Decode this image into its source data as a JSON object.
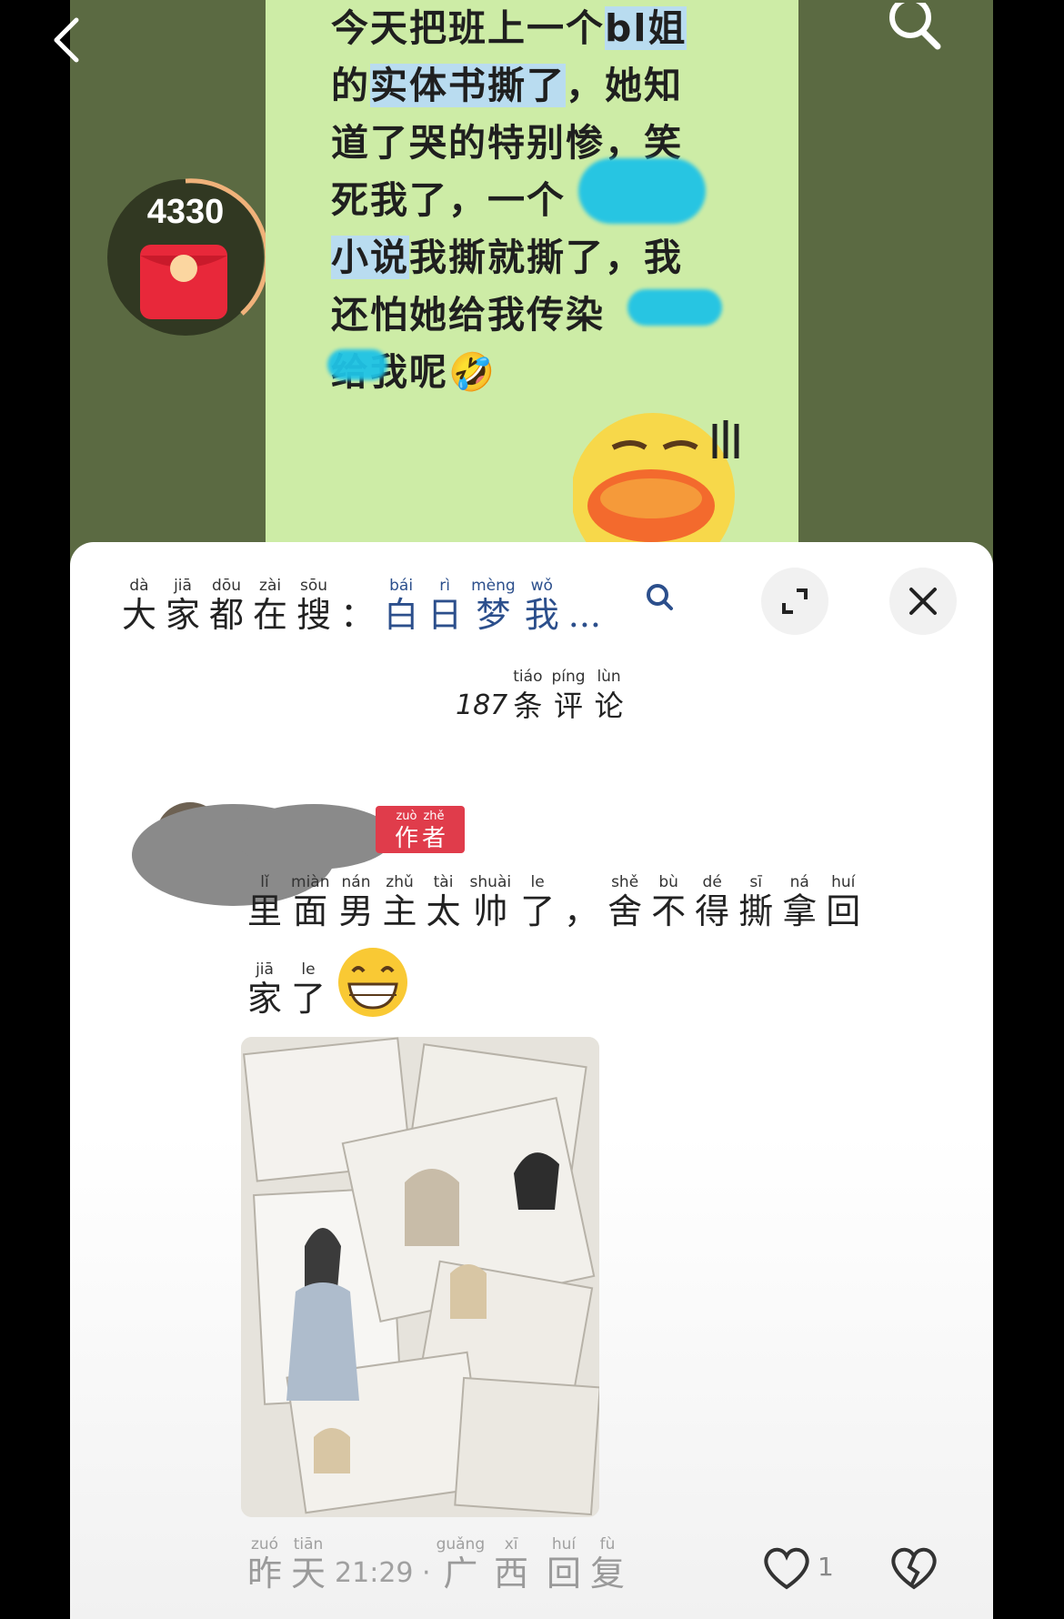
{
  "top_bar": {
    "back_icon": "chevron-left-icon",
    "search_icon": "search-icon"
  },
  "note": {
    "lines": [
      {
        "text": "今天把班上一个bl姐",
        "highlight": "bl姐"
      },
      {
        "text": "的实体书撕了，她知",
        "highlight": "实体书撕了"
      },
      {
        "text": "道了哭的特别惨，笑"
      },
      {
        "text": "死我了，一个"
      },
      {
        "text": "小说我撕就撕了，我",
        "highlight": "小说"
      },
      {
        "text": "还怕她给我传染"
      },
      {
        "text": "给我呢🤣"
      }
    ]
  },
  "red_packet": {
    "count": "4330",
    "icon": "red-packet-icon"
  },
  "sheet": {
    "search": {
      "label": [
        {
          "hz": "大",
          "py": "dà"
        },
        {
          "hz": "家",
          "py": "jiā"
        },
        {
          "hz": "都",
          "py": "dōu"
        },
        {
          "hz": "在",
          "py": "zài"
        },
        {
          "hz": "搜",
          "py": "sōu"
        }
      ],
      "colon": "：",
      "query": [
        {
          "hz": "白",
          "py": "bái"
        },
        {
          "hz": "日",
          "py": "rì"
        },
        {
          "hz": "梦",
          "py": "mèng"
        },
        {
          "hz": "我",
          "py": "wǒ"
        }
      ],
      "ellipsis": "...",
      "icon": "search-icon"
    },
    "expand_icon": "expand-icon",
    "close_icon": "close-icon",
    "comment_count": {
      "number": "187",
      "label": [
        {
          "hz": "条",
          "py": "tiáo"
        },
        {
          "hz": "评",
          "py": "píng"
        },
        {
          "hz": "论",
          "py": "lùn"
        }
      ]
    },
    "comment": {
      "author_badge": [
        {
          "hz": "作",
          "py": "zuò"
        },
        {
          "hz": "者",
          "py": "zhě"
        }
      ],
      "line1": [
        {
          "hz": "里",
          "py": "lǐ"
        },
        {
          "hz": "面",
          "py": "miàn"
        },
        {
          "hz": "男",
          "py": "nán"
        },
        {
          "hz": "主",
          "py": "zhǔ"
        },
        {
          "hz": "太",
          "py": "tài"
        },
        {
          "hz": "帅",
          "py": "shuài"
        },
        {
          "hz": "了",
          "py": "le"
        },
        {
          "hz": "，",
          "py": ""
        },
        {
          "hz": "舍",
          "py": "shě"
        },
        {
          "hz": "不",
          "py": "bù"
        },
        {
          "hz": "得",
          "py": "dé"
        },
        {
          "hz": "撕",
          "py": "sī"
        },
        {
          "hz": "拿",
          "py": "ná"
        },
        {
          "hz": "回",
          "py": "huí"
        }
      ],
      "line2": [
        {
          "hz": "家",
          "py": "jiā"
        },
        {
          "hz": "了",
          "py": "le"
        }
      ],
      "emoji": "grinning-emoji",
      "image_alt": "torn-manga-pages-photo",
      "time_hz": [
        {
          "hz": "昨",
          "py": "zuó"
        },
        {
          "hz": "天",
          "py": "tiān"
        }
      ],
      "time": "21:29 ·",
      "location": [
        {
          "hz": "广",
          "py": "guǎng"
        },
        {
          "hz": "西",
          "py": "xī"
        }
      ],
      "reply": [
        {
          "hz": "回",
          "py": "huí"
        },
        {
          "hz": "复",
          "py": "fù"
        }
      ],
      "likes": "1",
      "like_icon": "heart-icon",
      "dislike_icon": "broken-heart-icon"
    }
  },
  "colors": {
    "video_bg": "#5b6a42",
    "note_bg": "#cdeca6",
    "highlight": "#b9dcf0",
    "author_badge": "#e03c4b",
    "link_blue": "#2c4f8c"
  }
}
